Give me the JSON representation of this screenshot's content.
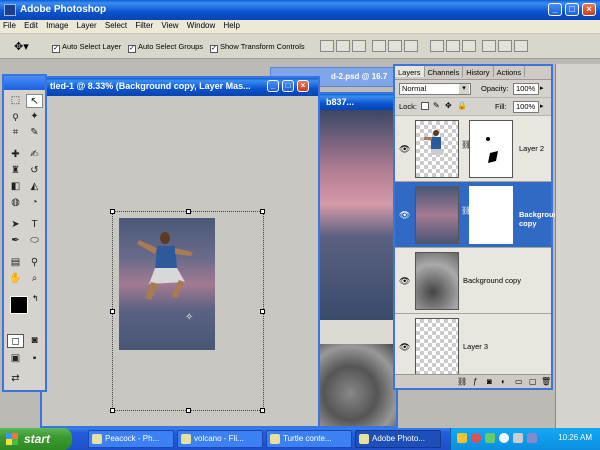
{
  "app": {
    "title": "Adobe Photoshop"
  },
  "menu": [
    "File",
    "Edit",
    "Image",
    "Layer",
    "Select",
    "Filter",
    "View",
    "Window",
    "Help"
  ],
  "options": {
    "auto_select_layer": "Auto Select Layer",
    "auto_select_groups": "Auto Select Groups",
    "show_transform_controls": "Show Transform Controls"
  },
  "document": {
    "title": "tled-1 @ 8.33% (Background copy, Layer Mas...",
    "bg_title1": "d-2.psd @ 16.7",
    "bg_title2": "b837..."
  },
  "layers_panel": {
    "tabs": [
      "Layers",
      "Channels",
      "History",
      "Actions"
    ],
    "blend_mode": "Normal",
    "opacity_label": "Opacity:",
    "opacity_value": "100%",
    "lock_label": "Lock:",
    "fill_label": "Fill:",
    "fill_value": "100%",
    "layers": [
      {
        "name": "Layer 2"
      },
      {
        "name": "Background copy"
      },
      {
        "name": "Background copy"
      },
      {
        "name": "Layer 3"
      }
    ]
  },
  "taskbar": {
    "start_label": "start",
    "tasks": [
      "Peacock - Ph...",
      "volcano - Fli...",
      "Turtle conte...",
      "Adobe Photo..."
    ],
    "clock": "10:26 AM"
  },
  "colors": {
    "xp_blue": "#0a53d0",
    "selected_layer": "#316ac5",
    "start_green": "#3a9a2e"
  }
}
